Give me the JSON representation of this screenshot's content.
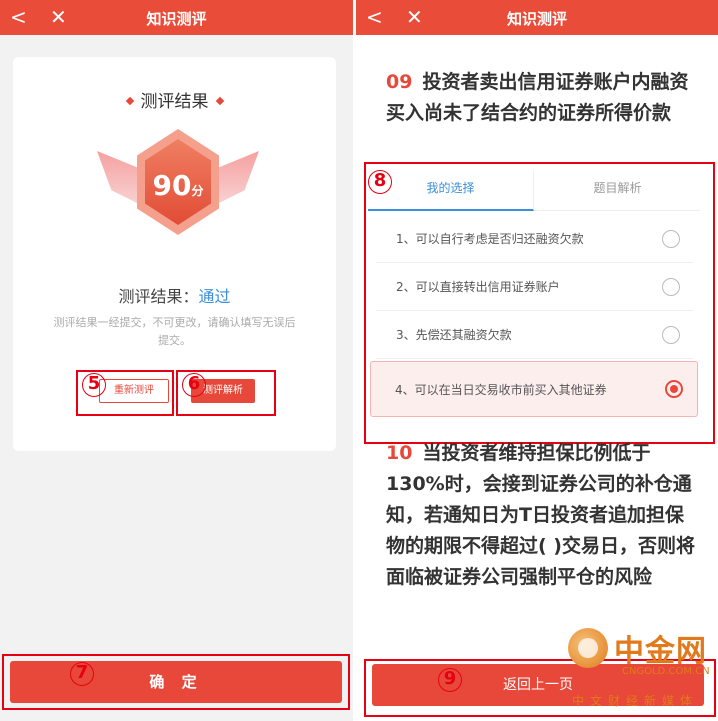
{
  "left": {
    "header": {
      "back": "<",
      "close": "✕",
      "title": "知识测评"
    },
    "card": {
      "result_title": "测评结果",
      "score": "90",
      "score_unit": "分",
      "result_label": "测评结果：",
      "result_value": "通过",
      "note": "测评结果一经提交，不可更改，请确认填写无误后提交。",
      "retest_label": "重新测评",
      "analysis_label": "测评解析"
    },
    "confirm_label": "确 定",
    "annotations": {
      "a5": "5",
      "a6": "6",
      "a7": "7"
    }
  },
  "right": {
    "header": {
      "back": "<",
      "close": "✕",
      "title": "知识测评"
    },
    "question": {
      "number": "09",
      "text": "投资者卖出信用证券账户内融资买入尚未了结合约的证券所得价款"
    },
    "tabs": {
      "mine": "我的选择",
      "analysis": "题目解析"
    },
    "options": [
      {
        "text": "1、可以自行考虑是否归还融资欠款",
        "selected": false
      },
      {
        "text": "2、可以直接转出信用证券账户",
        "selected": false
      },
      {
        "text": "3、先偿还其融资欠款",
        "selected": false
      },
      {
        "text": "4、可以在当日交易收市前买入其他证券",
        "selected": true
      }
    ],
    "question2": {
      "number": "10",
      "text": "当投资者维持担保比例低于130%时，会接到证券公司的补仓通知，若通知日为T日投资者追加担保物的期限不得超过( )交易日，否则将面临被证券公司强制平仓的风险"
    },
    "back_label": "返回上一页",
    "annotations": {
      "a8": "8",
      "a9": "9"
    }
  },
  "watermark": {
    "name": "中金网",
    "domain": "CNGOLD.COM.CN",
    "tagline": "中文财经新媒体"
  },
  "colors": {
    "brand_red": "#e8483a",
    "link_blue": "#3a8fd8",
    "annotation_red": "#e60012",
    "watermark_orange": "#e07a1c"
  }
}
